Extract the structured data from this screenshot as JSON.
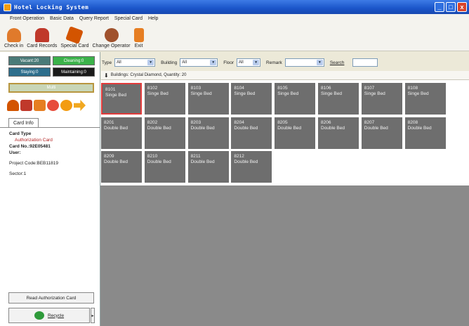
{
  "window": {
    "title": "Hotel Locking System",
    "buttons": [
      "_",
      "□",
      "x"
    ]
  },
  "menu": [
    "Front Operation",
    "Basic Data",
    "Query Report",
    "Special Card",
    "Help"
  ],
  "toolbar": [
    {
      "label": "Check in",
      "icon": "checkin-icon",
      "color": "#e07a2b"
    },
    {
      "label": "Card Records",
      "icon": "card-records-icon",
      "color": "#c0392b"
    },
    {
      "label": "Special Card",
      "icon": "special-card-icon",
      "color": "#d35400"
    },
    {
      "label": "Change Operator",
      "icon": "change-operator-icon",
      "color": "#a0522d"
    },
    {
      "label": "Exit",
      "icon": "exit-icon",
      "color": "#e67e22"
    }
  ],
  "stats": [
    {
      "label": "Vacant:20",
      "color": "#4a7a78"
    },
    {
      "label": "Cleaning:0",
      "color": "#3bb24a"
    },
    {
      "label": "Staying:0",
      "color": "#2d6e8c"
    },
    {
      "label": "Maintaining:0",
      "color": "#1a1a1a"
    }
  ],
  "multi_label": "Multi",
  "card_tab": "Card Info",
  "card_info": {
    "card_type_label": "Card Type",
    "card_type_value": "Authorization Card",
    "card_no": "Card No.:92E05481",
    "user": "User:",
    "project_code": "Project Code:BEB11819",
    "sector": "Sector:1"
  },
  "read_auth_button": "Read Authorization Card",
  "recycle_button": "Recycle",
  "filters": {
    "type_label": "Type",
    "type_value": "All",
    "building_label": "Building",
    "building_value": "All",
    "floor_label": "Floor",
    "floor_value": "All",
    "remark_label": "Remark",
    "remark_value": "",
    "search_label": "Search",
    "search_value": ""
  },
  "building_info": "Buildings: Crystal Diamond,  Quantity: 20",
  "rooms": [
    {
      "number": "8101",
      "type": "Singe Bed",
      "selected": true
    },
    {
      "number": "8102",
      "type": "Singe Bed"
    },
    {
      "number": "8103",
      "type": "Singe Bed"
    },
    {
      "number": "8104",
      "type": "Singe Bed"
    },
    {
      "number": "8105",
      "type": "Singe Bed"
    },
    {
      "number": "8106",
      "type": "Singe Bed"
    },
    {
      "number": "8107",
      "type": "Singe Bed"
    },
    {
      "number": "8108",
      "type": "Singe Bed"
    },
    {
      "number": "8201",
      "type": "Double Bed"
    },
    {
      "number": "8202",
      "type": "Double Bed"
    },
    {
      "number": "8203",
      "type": "Double Bed"
    },
    {
      "number": "8204",
      "type": "Double Bed"
    },
    {
      "number": "8205",
      "type": "Double Bed"
    },
    {
      "number": "8206",
      "type": "Double Bed"
    },
    {
      "number": "8207",
      "type": "Double Bed"
    },
    {
      "number": "8208",
      "type": "Double Bed"
    },
    {
      "number": "8209",
      "type": "Double Bed"
    },
    {
      "number": "8210",
      "type": "Double Bed"
    },
    {
      "number": "8211",
      "type": "Double Bed"
    },
    {
      "number": "8212",
      "type": "Double Bed"
    }
  ]
}
